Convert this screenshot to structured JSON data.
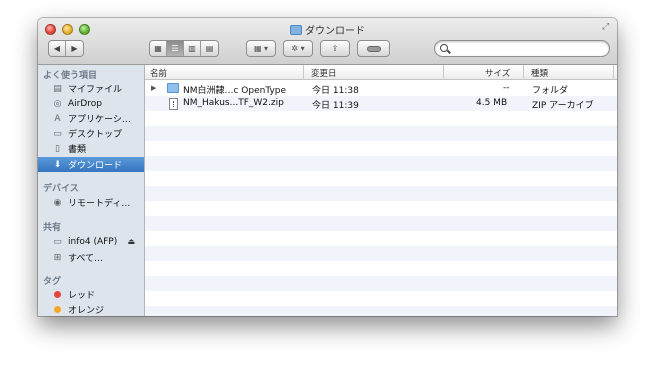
{
  "window": {
    "title": "ダウンロード"
  },
  "toolbar": {
    "back_icon": "back-arrow-icon",
    "forward_icon": "forward-arrow-icon",
    "view_modes": [
      "icon-view",
      "list-view",
      "column-view",
      "coverflow-view"
    ],
    "active_view": "list-view",
    "arrange_icon": "arrange-icon",
    "action_icon": "gear-icon",
    "share_icon": "share-icon",
    "label_icon": "label-icon",
    "search_placeholder": ""
  },
  "sidebar": {
    "favorites_header": "よく使う項目",
    "favorites": [
      {
        "label": "マイファイル",
        "icon": "all-files-icon"
      },
      {
        "label": "AirDrop",
        "icon": "airdrop-icon"
      },
      {
        "label": "アプリケーシ…",
        "icon": "applications-icon"
      },
      {
        "label": "デスクトップ",
        "icon": "desktop-icon"
      },
      {
        "label": "書類",
        "icon": "documents-icon"
      },
      {
        "label": "ダウンロード",
        "icon": "downloads-icon",
        "selected": true
      }
    ],
    "devices_header": "デバイス",
    "devices": [
      {
        "label": "リモートディ…",
        "icon": "remote-disc-icon"
      }
    ],
    "shared_header": "共有",
    "shared": [
      {
        "label": "info4 (AFP)",
        "icon": "server-icon",
        "eject": "⏏"
      },
      {
        "label": "すべて…",
        "icon": "network-icon"
      }
    ],
    "tags_header": "タグ",
    "tags": [
      {
        "label": "レッド",
        "color": "#e8433a"
      },
      {
        "label": "オレンジ",
        "color": "#f5a623"
      }
    ]
  },
  "columns": {
    "name": "名前",
    "modified": "変更日",
    "size": "サイズ",
    "kind": "種類"
  },
  "files": [
    {
      "name": "NM白洲隷…c OpenType",
      "modified": "今日 11:38",
      "size": "--",
      "kind": "フォルダ",
      "type": "folder"
    },
    {
      "name": "NM_Hakus...TF_W2.zip",
      "modified": "今日 11:39",
      "size": "4.5 MB",
      "kind": "ZIP アーカイブ",
      "type": "zip"
    }
  ],
  "colors": {
    "selection": "#3a7ec6",
    "sidebar_bg": "#dde4ec",
    "row_alt": "#f1f4fa"
  }
}
